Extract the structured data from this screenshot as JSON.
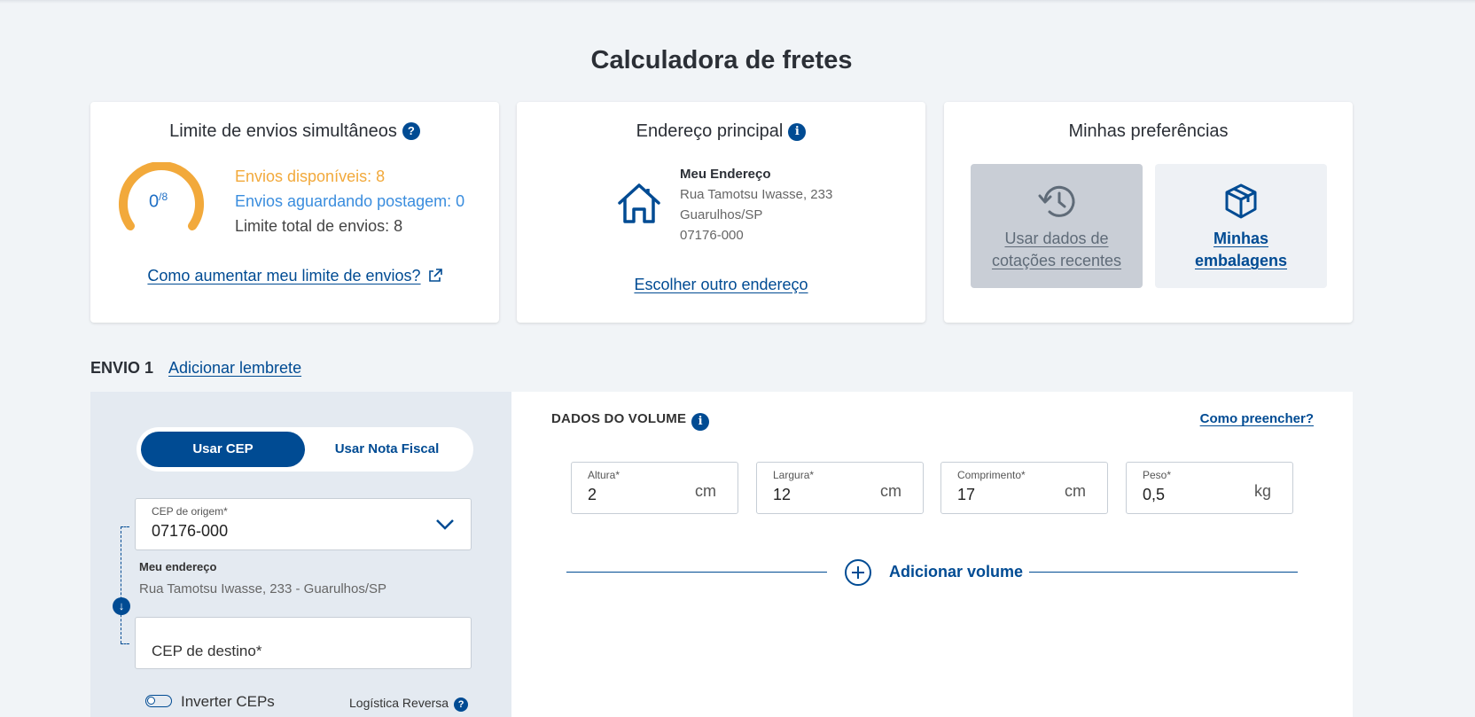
{
  "page": {
    "title": "Calculadora de fretes"
  },
  "limit_card": {
    "title": "Limite de envios simultâneos",
    "help_icon": "question-icon",
    "gauge_value": "0",
    "gauge_max": "/8",
    "available": "Envios disponíveis: 8",
    "awaiting": "Envios aguardando postagem: 0",
    "total": "Limite total de envios: 8",
    "increase_link": "Como aumentar meu limite de envios?",
    "colors": {
      "gauge": "#f2a93b",
      "available": "#f2a93b",
      "awaiting": "#3a8dde"
    }
  },
  "address_card": {
    "title": "Endereço principal",
    "info_icon": "info-icon",
    "name": "Meu Endereço",
    "street": "Rua Tamotsu Iwasse, 233",
    "city": "Guarulhos/SP",
    "zip": "07176-000",
    "change_link": "Escolher outro endereço"
  },
  "prefs_card": {
    "title": "Minhas preferências",
    "recent": {
      "line1": "Usar dados de",
      "line2": "cotações recentes",
      "icon": "history-icon"
    },
    "packages": {
      "line1": "Minhas",
      "line2": "embalagens",
      "icon": "box-icon"
    }
  },
  "envio": {
    "title": "ENVIO 1",
    "reminder_link": "Adicionar lembrete"
  },
  "left_panel": {
    "toggle_cep": "Usar CEP",
    "toggle_nf": "Usar Nota Fiscal",
    "origin": {
      "label": "CEP de origem*",
      "value": "07176-000"
    },
    "my_address_label": "Meu endereço",
    "my_address_value": "Rua Tamotsu Iwasse, 233 - Guarulhos/SP",
    "destination_placeholder": "CEP de destino*",
    "invert_label": "Inverter CEPs",
    "reverse_label": "Logística Reversa"
  },
  "volume": {
    "title": "DADOS DO VOLUME",
    "how_to_link": "Como preencher?",
    "fields": [
      {
        "label": "Altura*",
        "value": "2",
        "unit": "cm"
      },
      {
        "label": "Largura*",
        "value": "12",
        "unit": "cm"
      },
      {
        "label": "Comprimento*",
        "value": "17",
        "unit": "cm"
      },
      {
        "label": "Peso*",
        "value": "0,5",
        "unit": "kg"
      }
    ],
    "add_volume": "Adicionar volume"
  },
  "colors": {
    "brand": "#004b93",
    "background": "#f1f4f7",
    "left_panel": "#e4eaf1"
  }
}
